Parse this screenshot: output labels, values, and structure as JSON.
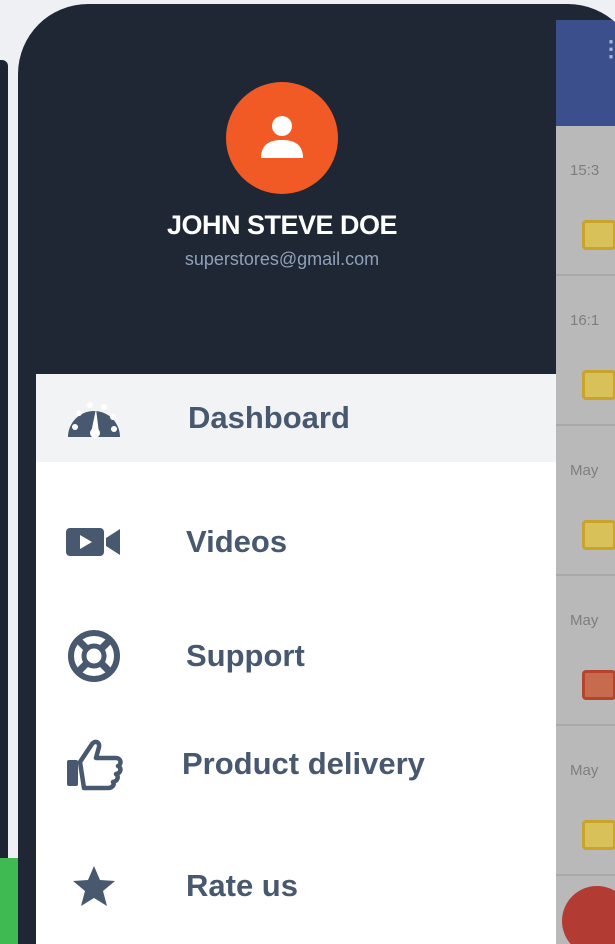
{
  "drawer": {
    "user": {
      "name": "JOHN STEVE DOE",
      "email": "superstores@gmail.com",
      "avatar_icon": "user-icon",
      "avatar_color": "#f15a24"
    },
    "header_color": "#1f2734",
    "menu_items": [
      {
        "label": "Dashboard",
        "icon": "dashboard-gauge-icon",
        "active": true
      },
      {
        "label": "Videos",
        "icon": "video-camera-icon",
        "active": false
      },
      {
        "label": "Support",
        "icon": "lifebuoy-icon",
        "active": false
      },
      {
        "label": "Product delivery",
        "icon": "thumbs-up-icon",
        "active": false
      },
      {
        "label": "Rate us",
        "icon": "star-icon",
        "active": false
      }
    ],
    "text_color": "#48586e"
  },
  "background_app": {
    "times": [
      "15:3",
      "16:1",
      "May",
      "May",
      "May"
    ],
    "bar_color": "#3b4f8c"
  }
}
